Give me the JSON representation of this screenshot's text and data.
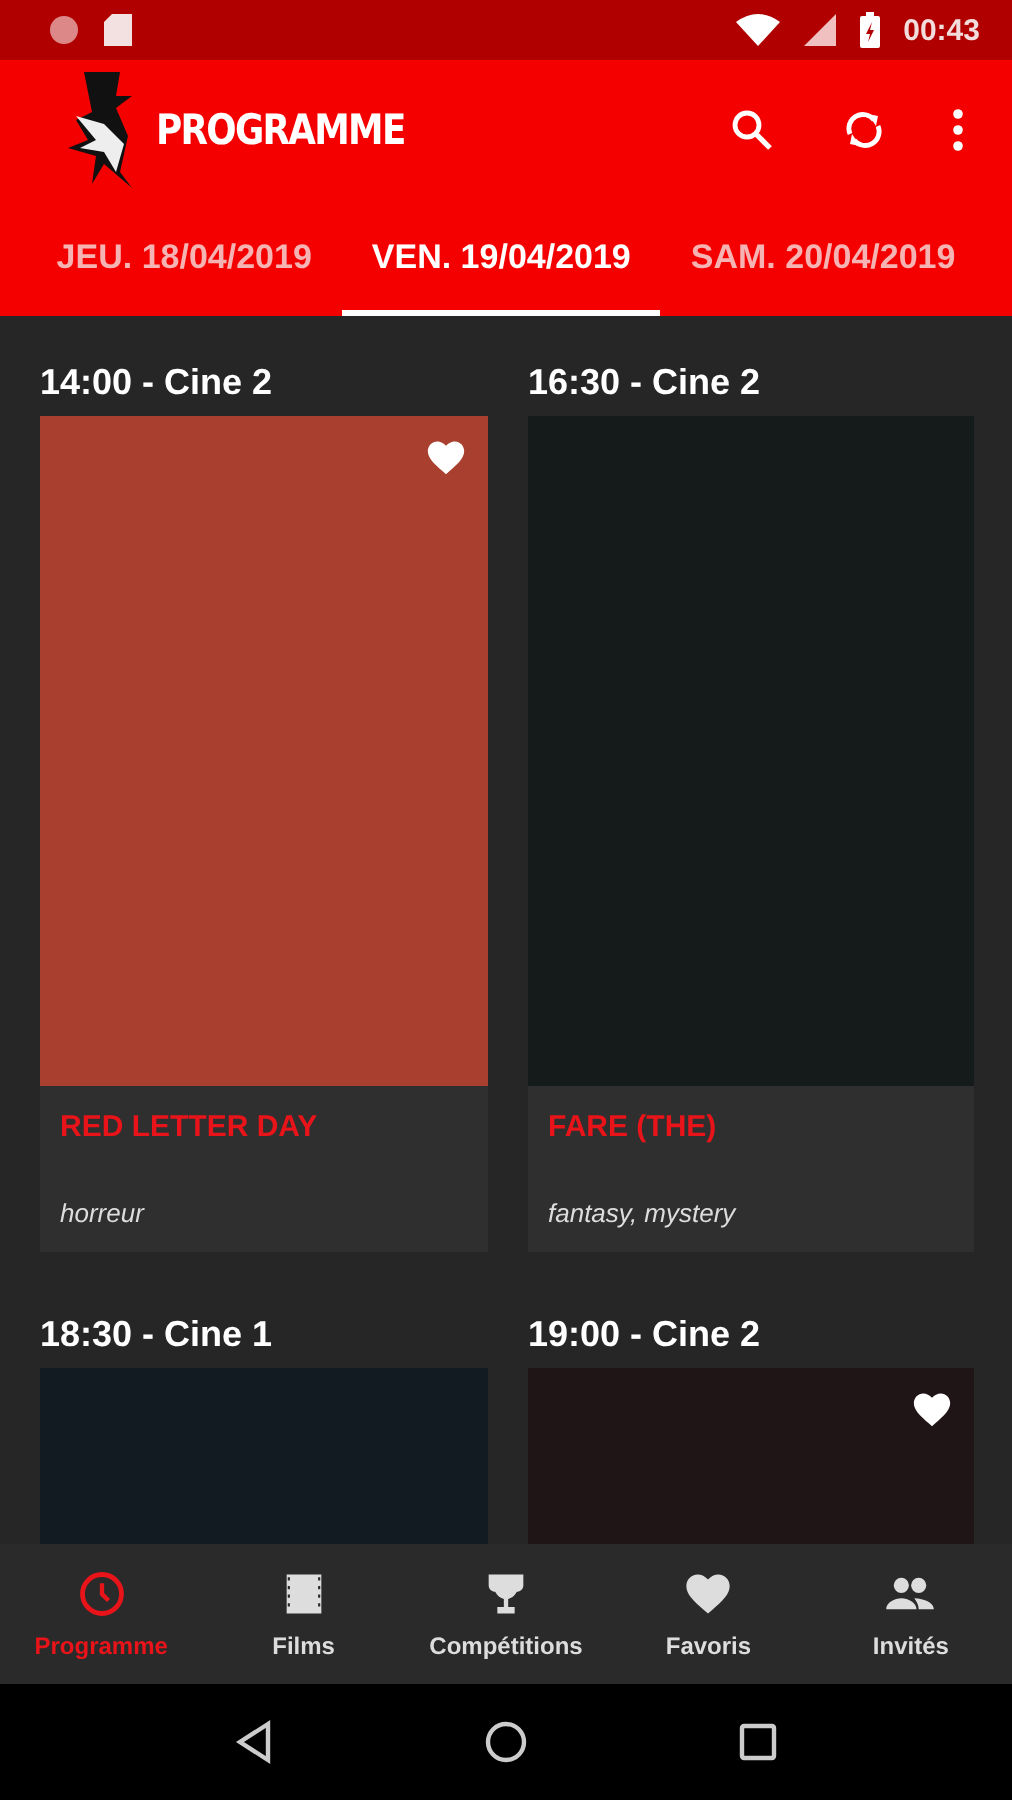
{
  "status_bar": {
    "time": "00:43"
  },
  "app_bar": {
    "title": "PROGRAMME"
  },
  "tabs": [
    {
      "label": "JEU. 18/04/2019",
      "selected": false
    },
    {
      "label": "VEN. 19/04/2019",
      "selected": true
    },
    {
      "label": "SAM. 20/04/2019",
      "selected": false
    }
  ],
  "screenings": [
    {
      "time": "14:00 - Cine 2",
      "color": "#a9402f",
      "favorite": true,
      "title": "RED LETTER DAY",
      "genres": "horreur"
    },
    {
      "time": "16:30 - Cine 2",
      "color": "#141b1a",
      "favorite": false,
      "title": "FARE (THE)",
      "genres": "fantasy, mystery"
    },
    {
      "time": "18:30 - Cine 1",
      "color": "#121a22",
      "favorite": false
    },
    {
      "time": "19:00 - Cine 2",
      "color": "#1f1416",
      "favorite": true
    }
  ],
  "bottom_nav": [
    {
      "label": "Programme",
      "kind": "clock",
      "selected": true
    },
    {
      "label": "Films",
      "kind": "film",
      "selected": false
    },
    {
      "label": "Compétitions",
      "kind": "trophy",
      "selected": false
    },
    {
      "label": "Favoris",
      "kind": "heart",
      "selected": false
    },
    {
      "label": "Invités",
      "kind": "people",
      "selected": false
    }
  ]
}
